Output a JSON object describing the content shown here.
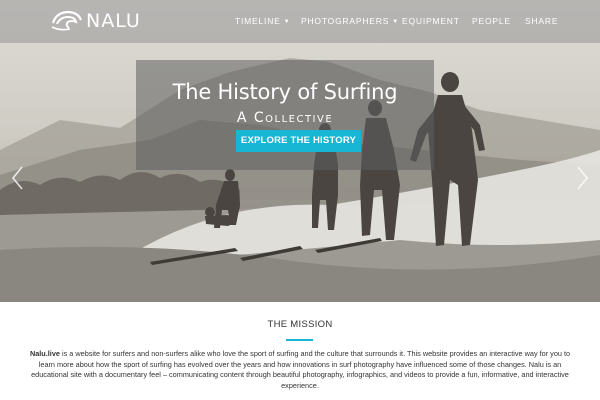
{
  "brand": {
    "name": "NALU"
  },
  "nav": {
    "items": [
      {
        "label": "TIMELINE",
        "has_dropdown": true
      },
      {
        "label": "PHOTOGRAPHERS",
        "has_dropdown": true
      },
      {
        "label": "EQUIPMENT",
        "has_dropdown": false
      },
      {
        "label": "PEOPLE",
        "has_dropdown": false
      },
      {
        "label": "SHARE",
        "has_dropdown": false
      }
    ],
    "caret": "▼"
  },
  "hero": {
    "title": "The History of Surfing",
    "subtitle": "A Collective",
    "cta_label": "EXPLORE THE HISTORY",
    "prev_icon": "chevron-left-icon",
    "next_icon": "chevron-right-icon"
  },
  "mission": {
    "title": "THE MISSION",
    "site_name": "Nalu.live",
    "body": " is a website for surfers and non-surfers alike who love the sport of surfing and the culture that surrounds it. This website provides an interactive way for you to learn more about how the sport of surfing has evolved over the years and how innovations in surf photography have influenced some of those changes. Nalu is an educational site with a documentary feel – communicating content through beautiful photography, infographics, and videos to provide a fun, informative, and interactive experience."
  },
  "colors": {
    "accent": "#17b6d4",
    "nav_bg": "#969696",
    "text": "#333333"
  }
}
